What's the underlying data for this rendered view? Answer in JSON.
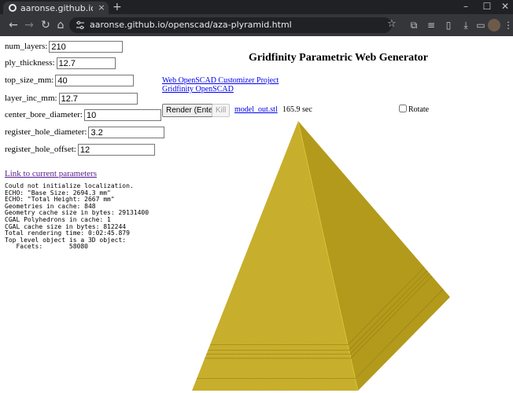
{
  "browser": {
    "tab_title": "aaronse.github.io/openscad/aza-",
    "tab_close": "×",
    "new_tab": "+",
    "url": "aaronse.github.io/openscad/aza-plyramid.html",
    "window_controls": {
      "minimize": "–",
      "maximize": "☐",
      "close": "✕"
    }
  },
  "app": {
    "title": "Gridfinity Parametric Web Generator",
    "links": [
      "Web OpenSCAD Customizer Project",
      "Gridfinity OpenSCAD"
    ],
    "render_button": "Render (Enter)",
    "kill_button": "Kill",
    "output_file": "model_out.stl",
    "render_time": "165.9 sec",
    "rotate_label": "Rotate",
    "rotate_checked": false
  },
  "params": [
    {
      "label": "num_layers:",
      "value": "210"
    },
    {
      "label": "ply_thickness:",
      "value": "12.7"
    },
    {
      "label": "top_size_mm:",
      "value": "40"
    },
    {
      "label": "layer_inc_mm:",
      "value": "12.7"
    },
    {
      "label": "center_bore_diameter:",
      "value": "10"
    },
    {
      "label": "register_hole_diameter:",
      "value": "3.2"
    },
    {
      "label": "register_hole_offset:",
      "value": "12"
    }
  ],
  "params_link": "Link to current parameters",
  "console_lines": [
    "Could not initialize localization.",
    "ECHO: \"Base Size: 2694.3 mm\"",
    "ECHO: \"Total Height: 2667 mm\"",
    "Geometries in cache: 848",
    "Geometry cache size in bytes: 29131400",
    "CGAL Polyhedrons in cache: 1",
    "CGAL cache size in bytes: 812244",
    "Total rendering time: 0:02:45.879",
    "Top level object is a 3D object:",
    "   Facets:       58080"
  ],
  "model": {
    "color_light": "#cbb22e",
    "color_mid": "#b59c1c",
    "color_dark": "#9a8214"
  }
}
